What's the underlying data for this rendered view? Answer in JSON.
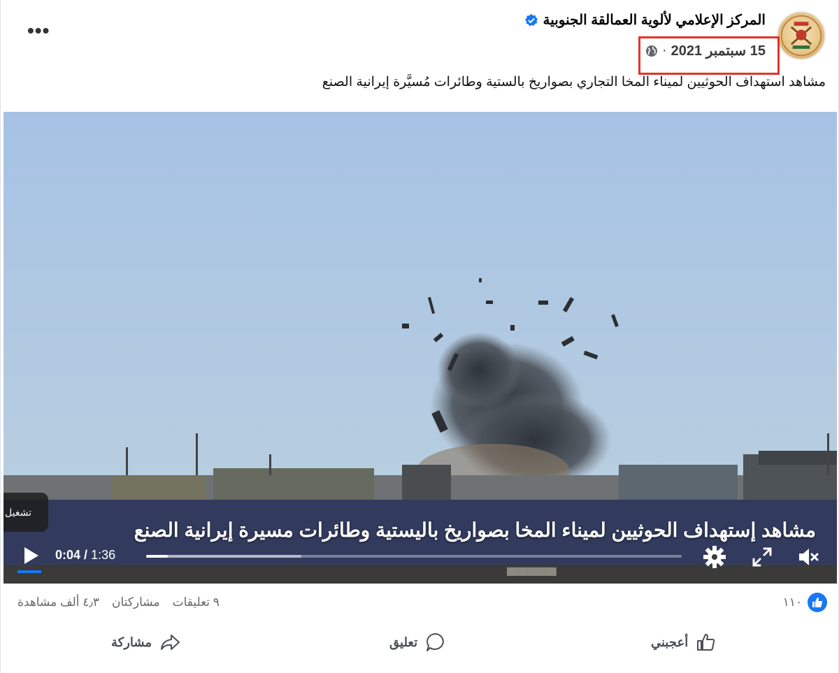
{
  "post": {
    "page_name": "المركز الإعلامي لألوية العمالقة الجنوبية",
    "date": "15 سبتمبر 2021",
    "dot": "·",
    "caption": "مشاهد استهداف الحوثيين لميناء المخا التجاري بصواريخ بالستية وطائرات مُسيَّرة إيرانية الصنع",
    "more_label": "•••"
  },
  "video": {
    "overlay_text": "مشاهد إستهداف الحوثيين لميناء المخا بصواريخ باليستية وطائرات مسيرة إيرانية الصنع",
    "play_tooltip": "تشغيل",
    "current_time": "0:04",
    "separator": "/",
    "duration": "1:36",
    "progress_fraction": 0.04,
    "buffered_fraction": 0.29,
    "icons": [
      "play-icon",
      "settings-icon",
      "fullscreen-icon",
      "mute-icon"
    ]
  },
  "stats": {
    "reaction_count": "١١٠",
    "comments": "٩ تعليقات",
    "shares": "مشاركتان",
    "views": "٤٫٣ ألف مشاهدة"
  },
  "actions": {
    "like": "أعجبني",
    "comment": "تعليق",
    "share": "مشاركة"
  },
  "colors": {
    "brand_blue": "#1877f2",
    "highlight_red": "#e2352a",
    "sky": "#a9c4e3"
  }
}
